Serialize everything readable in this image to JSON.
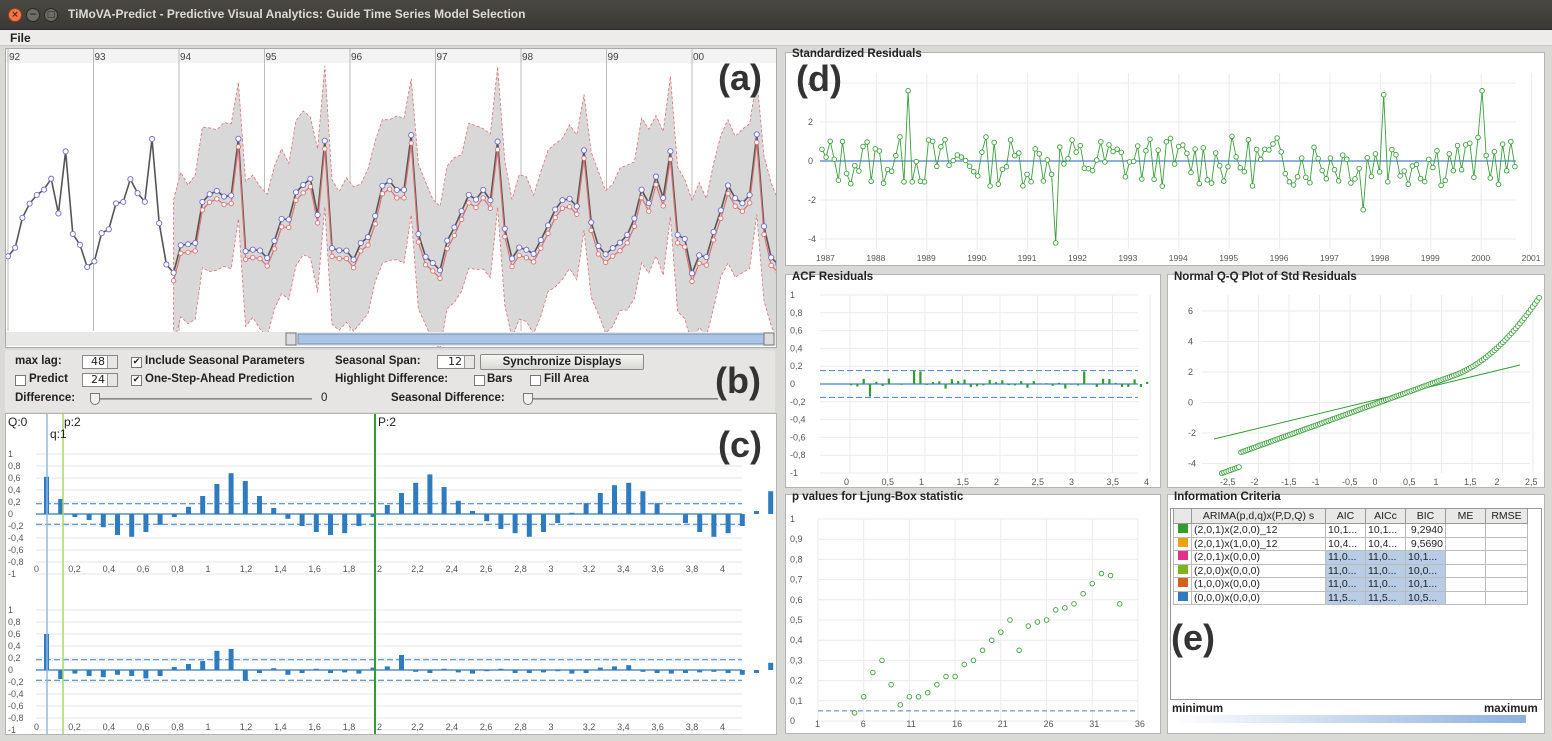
{
  "window": {
    "title": "TiMoVA-Predict - Predictive Visual Analytics: Guide Time Series Model Selection"
  },
  "menu": {
    "file": "File"
  },
  "labels": {
    "a": "(a)",
    "b": "(b)",
    "c": "(c)",
    "d": "(d)",
    "e": "(e)"
  },
  "timeline": {
    "years": [
      "92",
      "93",
      "94",
      "95",
      "96",
      "97",
      "98",
      "99",
      "00"
    ]
  },
  "controls": {
    "max_lag_label": "max lag:",
    "max_lag_value": "48",
    "include_seasonal": "Include Seasonal Parameters",
    "seasonal_span_label": "Seasonal Span:",
    "seasonal_span_value": "12",
    "sync_button": "Synchronize Displays",
    "predict_label": "Predict",
    "predict_value": "24",
    "one_step": "One-Step-Ahead Prediction",
    "highlight_label": "Highlight Difference:",
    "bars": "Bars",
    "fill_area": "Fill Area",
    "difference_label": "Difference:",
    "difference_value": "0",
    "seasonal_difference_label": "Seasonal Difference:"
  },
  "acf": {
    "markers": {
      "q0": "Q:0",
      "q1": "q:1",
      "p2": "p:2",
      "P2": "P:2"
    },
    "yticks": [
      "1",
      "0,8",
      "0,6",
      "0,4",
      "0,2",
      "0",
      "-0,2",
      "-0,4",
      "-0,6",
      "-0,8",
      "-1"
    ],
    "xticks": [
      "0",
      "0,2",
      "0,4",
      "0,6",
      "0,8",
      "1",
      "1,2",
      "1,4",
      "1,6",
      "1,8",
      "2",
      "2,2",
      "2,4",
      "2,6",
      "2,8",
      "3",
      "3,2",
      "3,4",
      "3,6",
      "3,8",
      "4"
    ]
  },
  "resid": {
    "title": "Standardized Residuals",
    "yticks": [
      "4",
      "2",
      "0",
      "-2",
      "-4"
    ],
    "xticks": [
      "1987",
      "1988",
      "1989",
      "1990",
      "1991",
      "1992",
      "1993",
      "1994",
      "1995",
      "1996",
      "1997",
      "1998",
      "1999",
      "2000",
      "2001"
    ]
  },
  "acf_resid": {
    "title": "ACF Residuals",
    "yticks": [
      "1",
      "0,8",
      "0,6",
      "0,4",
      "0,2",
      "0",
      "-0,2",
      "-0,4",
      "-0,6",
      "-0,8",
      "-1"
    ],
    "xticks": [
      "0",
      "0,5",
      "1",
      "1,5",
      "2",
      "2,5",
      "3",
      "3,5",
      "4"
    ]
  },
  "qq": {
    "title": "Normal Q-Q Plot of Std Residuals",
    "yticks": [
      "6",
      "4",
      "2",
      "0",
      "-2",
      "-4"
    ],
    "xticks": [
      "-2,5",
      "-2",
      "-1,5",
      "-1",
      "-0,5",
      "0",
      "0,5",
      "1",
      "1,5",
      "2",
      "2,5"
    ]
  },
  "ljung": {
    "title": "p values for Ljung-Box statistic",
    "yticks": [
      "1",
      "0,9",
      "0,8",
      "0,7",
      "0,6",
      "0,5",
      "0,4",
      "0,3",
      "0,2",
      "0,1",
      "0"
    ],
    "xticks": [
      "1",
      "6",
      "11",
      "16",
      "21",
      "26",
      "31",
      "36"
    ]
  },
  "ic": {
    "title": "Information Criteria",
    "headers": [
      "",
      "ARIMA(p,d,q)x(P,D,Q) s",
      "AIC",
      "AICc",
      "BIC",
      "ME",
      "RMSE"
    ],
    "rows": [
      {
        "color": "#2e9e2e",
        "model": "(2,0,1)x(2,0,0)_12",
        "aic": "10,1...",
        "aicc": "10,1...",
        "bic": "9,2940",
        "hl": false
      },
      {
        "color": "#e8a317",
        "model": "(2,0,1)x(1,0,0)_12",
        "aic": "10,4...",
        "aicc": "10,4...",
        "bic": "9,5690",
        "hl": false
      },
      {
        "color": "#e0308a",
        "model": "(2,0,1)x(0,0,0)",
        "aic": "11,0...",
        "aicc": "11,0...",
        "bic": "10,1...",
        "hl": true
      },
      {
        "color": "#7ab51d",
        "model": "(2,0,0)x(0,0,0)",
        "aic": "11,0...",
        "aicc": "11,0...",
        "bic": "10,0...",
        "hl": true
      },
      {
        "color": "#d4601a",
        "model": "(1,0,0)x(0,0,0)",
        "aic": "11,0...",
        "aicc": "11,0...",
        "bic": "10,1...",
        "hl": true
      },
      {
        "color": "#2f7bbf",
        "model": "(0,0,0)x(0,0,0)",
        "aic": "11,5...",
        "aicc": "11,5...",
        "bic": "10,5...",
        "hl": true
      }
    ],
    "minimum": "minimum",
    "maximum": "maximum"
  }
}
